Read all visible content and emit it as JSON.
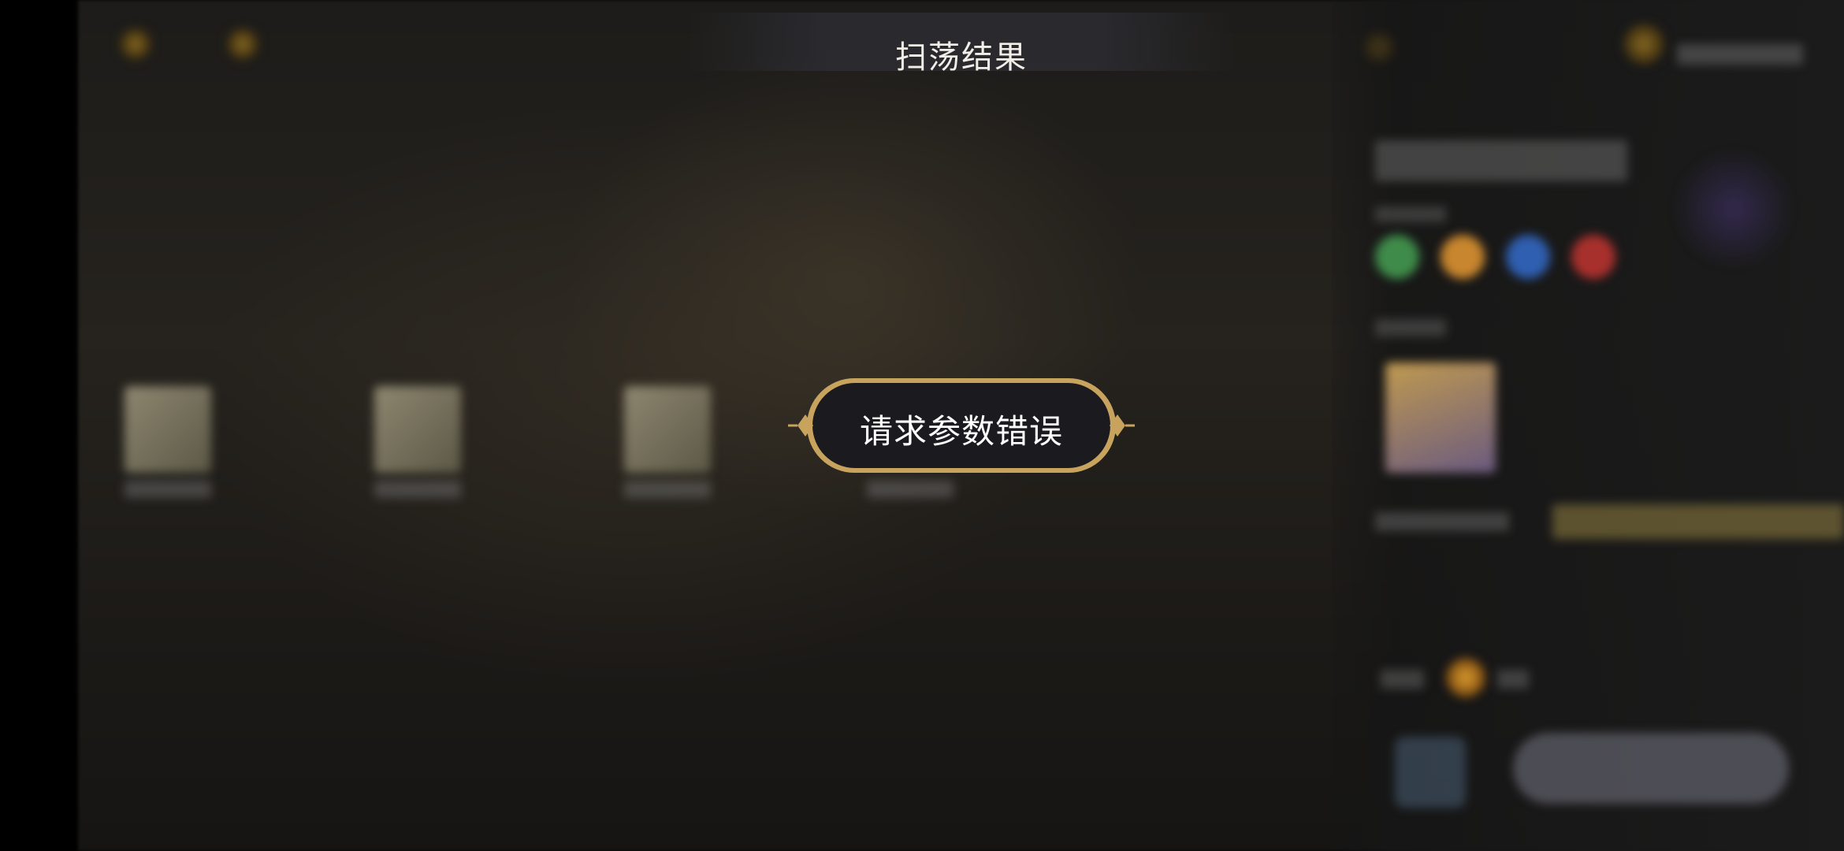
{
  "header": {
    "title": "扫荡结果"
  },
  "toast": {
    "message": "请求参数错误"
  },
  "colors": {
    "toast_border": "#c8a35e",
    "toast_fill": "#1b1a1f",
    "title_text": "#f2efe8"
  },
  "icons": {
    "left_top_1": "gold-orb-icon",
    "left_top_2": "gold-orb-icon",
    "resource": "resource-coin-icon"
  }
}
